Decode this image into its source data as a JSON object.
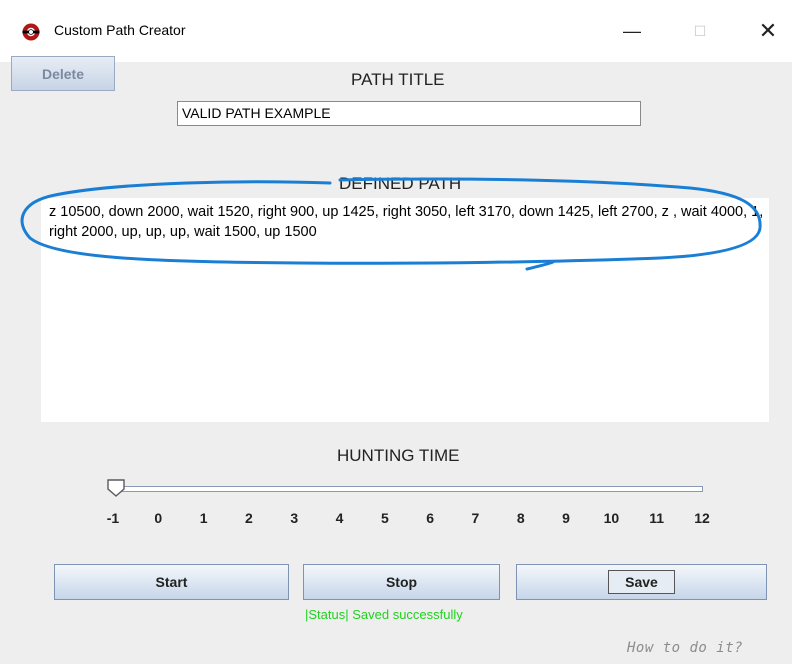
{
  "window": {
    "title": "Custom Path Creator",
    "minimize": "—",
    "maximize": "☐",
    "close": "✕"
  },
  "toolbar": {
    "delete_label": "Delete"
  },
  "path_title": {
    "label": "PATH TITLE",
    "value": "VALID PATH EXAMPLE"
  },
  "defined_path": {
    "label": "DEFINED PATH",
    "value": "z 10500, down 2000, wait 1520, right 900, up 1425, right 3050, left 3170, down 1425, left 2700, z ,  wait 4000, 1, right 2000, up, up, up, wait 1500, up 1500"
  },
  "hunting_time": {
    "label": "HUNTING TIME",
    "min": -1,
    "max": 12,
    "value": -1,
    "ticks": [
      "-1",
      "0",
      "1",
      "2",
      "3",
      "4",
      "5",
      "6",
      "7",
      "8",
      "9",
      "10",
      "11",
      "12"
    ]
  },
  "buttons": {
    "start": "Start",
    "stop": "Stop",
    "save": "Save"
  },
  "status": {
    "text": "|Status| Saved successfully",
    "color": "#1fd21f"
  },
  "help": {
    "link": "How to do it?"
  },
  "colors": {
    "annotation": "#1a7fd4",
    "status": "#1fd21f"
  }
}
